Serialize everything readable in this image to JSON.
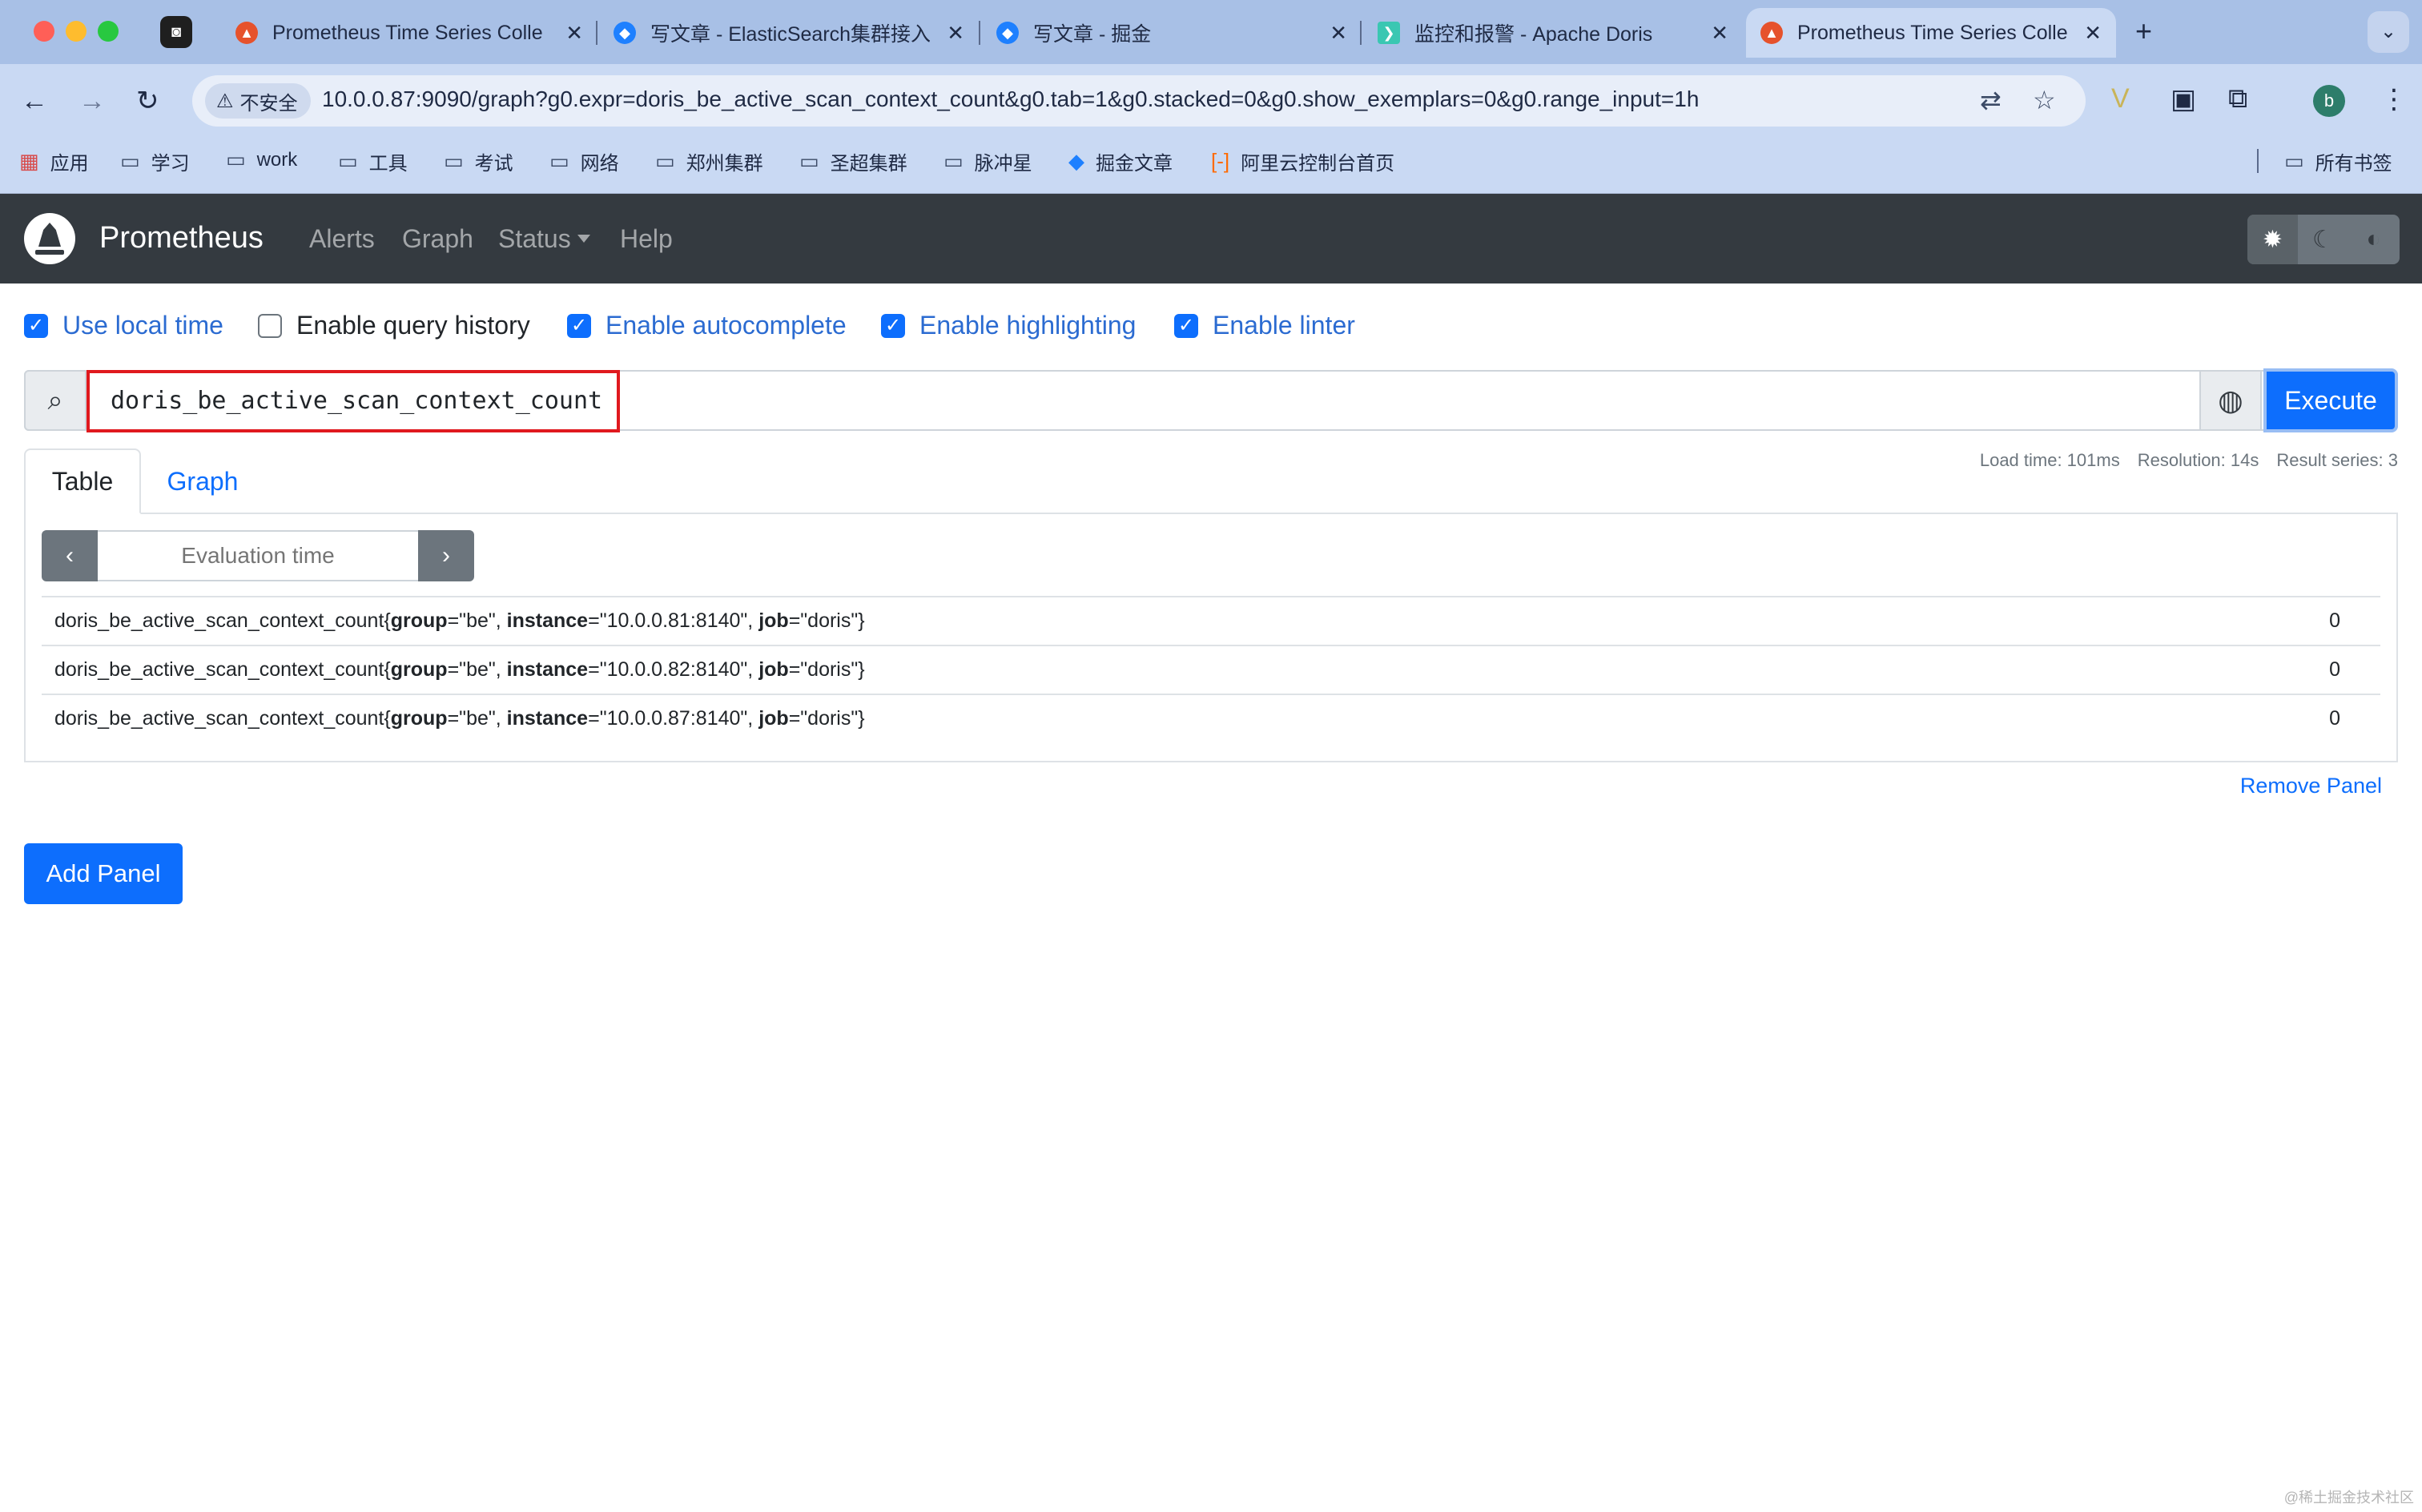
{
  "browser": {
    "pinned_tab_icon": "robot-icon",
    "tabs": [
      {
        "title": "Prometheus Time Series Colle",
        "favicon": "prometheus-favicon",
        "favicon_color": "#e6522c",
        "close": "✕"
      },
      {
        "title": "写文章 - ElasticSearch集群接入",
        "favicon": "juejin-favicon",
        "favicon_color": "#1e80ff",
        "close": "✕"
      },
      {
        "title": "写文章 - 掘金",
        "favicon": "juejin-favicon",
        "favicon_color": "#1e80ff",
        "close": "✕"
      },
      {
        "title": "监控和报警 - Apache Doris",
        "favicon": "doris-favicon",
        "favicon_color": "#3ac7b2",
        "close": "✕"
      },
      {
        "title": "Prometheus Time Series Colle",
        "favicon": "prometheus-favicon",
        "favicon_color": "#e6522c",
        "close": "✕",
        "active": true
      }
    ],
    "new_tab": "+",
    "tab_menu": "⌄",
    "security_label": "不安全",
    "url": "10.0.0.87:9090/graph?g0.expr=doris_be_active_scan_context_count&g0.tab=1&g0.stacked=0&g0.show_exemplars=0&g0.range_input=1h",
    "profile_initial": "b",
    "bookmarks": [
      "应用",
      "学习",
      "work",
      "工具",
      "考试",
      "网络",
      "郑州集群",
      "圣超集群",
      "脉冲星",
      "掘金文章",
      "阿里云控制台首页"
    ],
    "all_bookmarks": "所有书签"
  },
  "navbar": {
    "brand": "Prometheus",
    "links": [
      "Alerts",
      "Graph",
      "Status",
      "Help"
    ]
  },
  "options": [
    {
      "label": "Use local time",
      "checked": true
    },
    {
      "label": "Enable query history",
      "checked": false
    },
    {
      "label": "Enable autocomplete",
      "checked": true
    },
    {
      "label": "Enable highlighting",
      "checked": true
    },
    {
      "label": "Enable linter",
      "checked": true
    }
  ],
  "query": {
    "value": "doris_be_active_scan_context_count",
    "execute_label": "Execute"
  },
  "panel": {
    "tabs": [
      "Table",
      "Graph"
    ],
    "active_tab": "Table",
    "stats": {
      "load_time": "Load time: 101ms",
      "resolution": "Resolution: 14s",
      "result_series": "Result series: 3"
    },
    "eval_placeholder": "Evaluation time",
    "rows": [
      {
        "metric": "doris_be_active_scan_context_count",
        "labels": [
          [
            "group",
            "be"
          ],
          [
            "instance",
            "10.0.0.81:8140"
          ],
          [
            "job",
            "doris"
          ]
        ],
        "value": "0"
      },
      {
        "metric": "doris_be_active_scan_context_count",
        "labels": [
          [
            "group",
            "be"
          ],
          [
            "instance",
            "10.0.0.82:8140"
          ],
          [
            "job",
            "doris"
          ]
        ],
        "value": "0"
      },
      {
        "metric": "doris_be_active_scan_context_count",
        "labels": [
          [
            "group",
            "be"
          ],
          [
            "instance",
            "10.0.0.87:8140"
          ],
          [
            "job",
            "doris"
          ]
        ],
        "value": "0"
      }
    ],
    "remove_label": "Remove Panel"
  },
  "add_panel_label": "Add Panel",
  "watermark": "@稀土掘金技术社区"
}
